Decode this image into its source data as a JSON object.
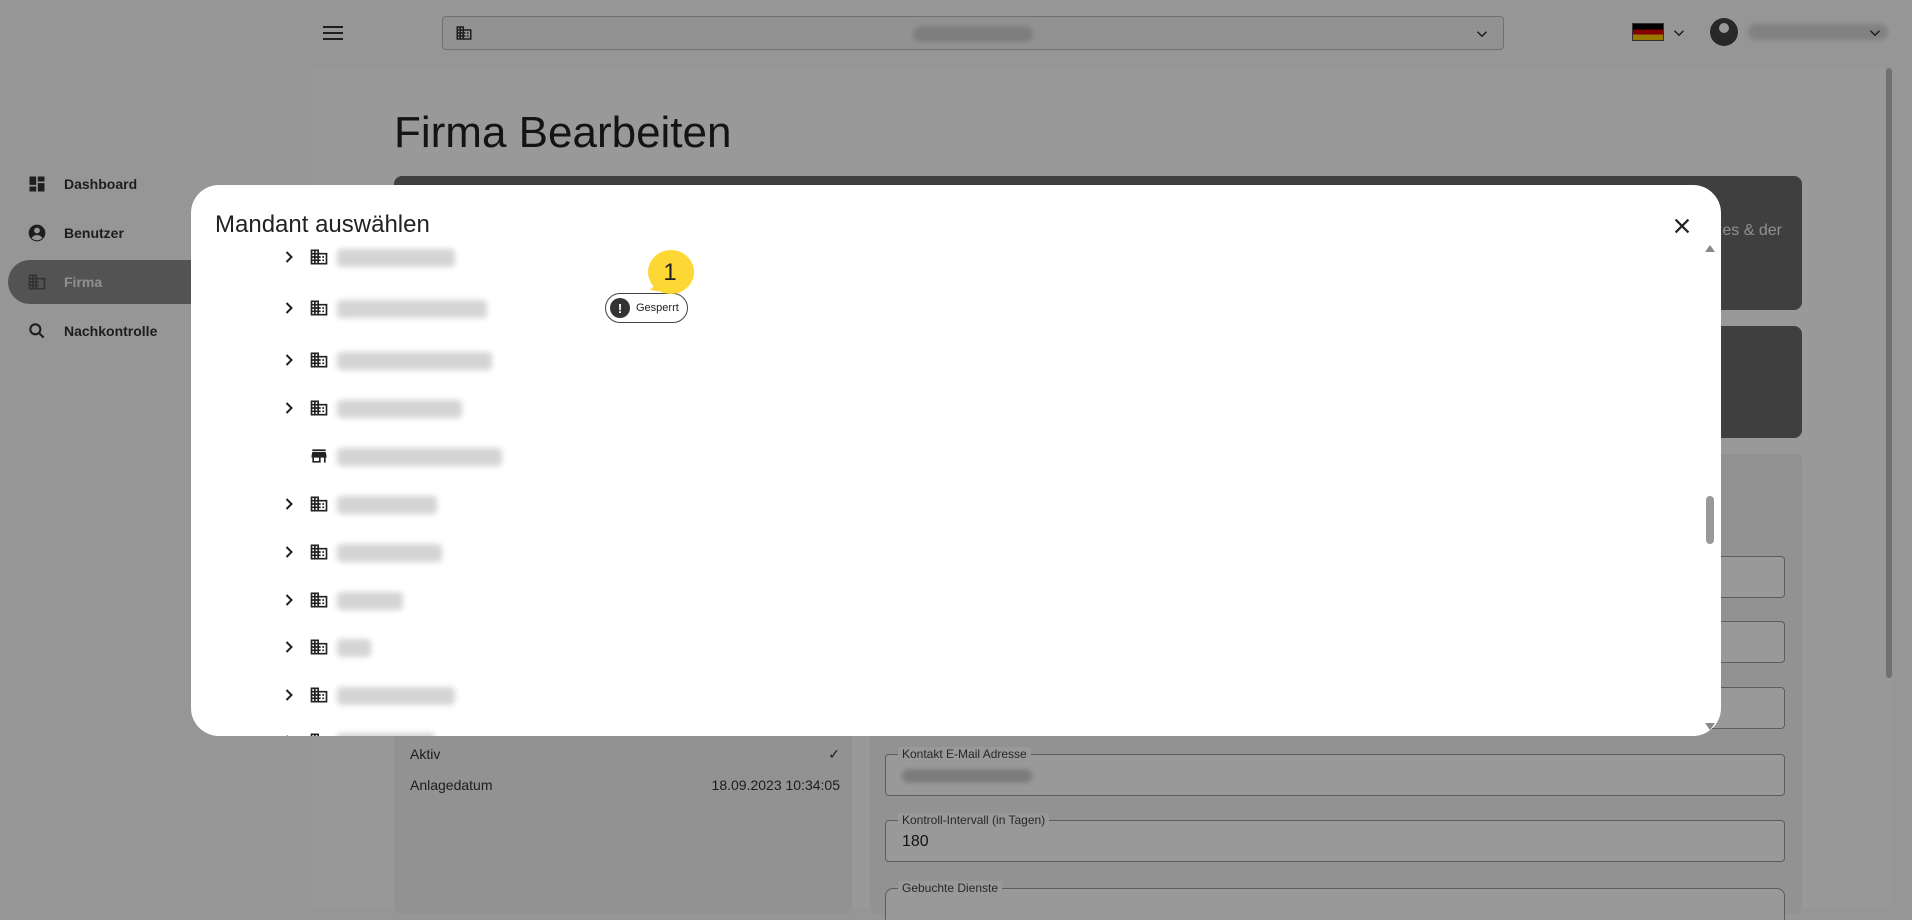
{
  "header": {
    "tenant_select": {
      "icon": "building-icon",
      "value": ""
    },
    "language": {
      "flag": "de-flag"
    },
    "user": {
      "name": ""
    }
  },
  "sidebar": {
    "items": [
      {
        "label": "Dashboard",
        "icon": "dashboard-icon",
        "active": false
      },
      {
        "label": "Benutzer",
        "icon": "account-circle-icon",
        "active": false
      },
      {
        "label": "Firma",
        "icon": "building-icon",
        "active": true
      },
      {
        "label": "Nachkontrolle",
        "icon": "search-icon",
        "active": false
      }
    ]
  },
  "main": {
    "title": "Firma Bearbeiten",
    "banner_text": "zes & der",
    "info": [
      {
        "label": "Aktiv",
        "value": "✓"
      },
      {
        "label": "Anlagedatum",
        "value": "18.09.2023 10:34:05"
      }
    ],
    "fields": {
      "contact_email": {
        "label": "Kontakt E-Mail Adresse",
        "value": ""
      },
      "control_interval": {
        "label": "Kontroll-Intervall (in Tagen)",
        "value": "180"
      },
      "booked_services": {
        "label": "Gebuchte Dienste"
      }
    }
  },
  "dialog": {
    "title": "Mandant auswählen",
    "badge_label": "Gesperrt",
    "tree_rows": [
      {
        "type": "company",
        "expandable": true,
        "badge": false
      },
      {
        "type": "company",
        "expandable": true,
        "badge": true
      },
      {
        "type": "company",
        "expandable": true,
        "badge": false
      },
      {
        "type": "company",
        "expandable": true,
        "badge": false
      },
      {
        "type": "store",
        "expandable": false,
        "badge": false
      },
      {
        "type": "company",
        "expandable": true,
        "badge": false
      },
      {
        "type": "company",
        "expandable": true,
        "badge": false
      },
      {
        "type": "company",
        "expandable": true,
        "badge": false
      },
      {
        "type": "company",
        "expandable": true,
        "badge": false
      },
      {
        "type": "company",
        "expandable": true,
        "badge": false
      },
      {
        "type": "company",
        "expandable": true,
        "badge": false
      }
    ]
  },
  "step_marker": {
    "number": "1",
    "color": "#fdd835"
  },
  "colors": {
    "overlay": "#000000",
    "active_nav": "#8a8a8a",
    "marker": "#fdd835"
  }
}
